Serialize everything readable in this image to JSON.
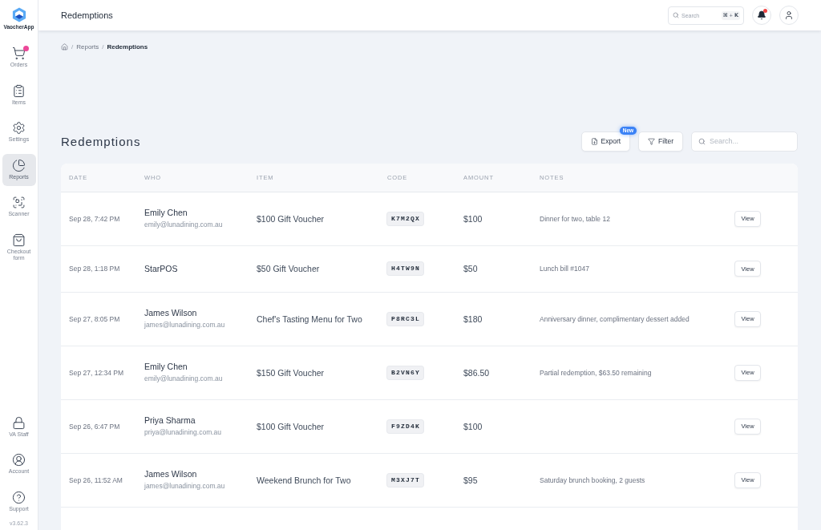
{
  "sidebar": {
    "logo": "VaocherApp",
    "items": [
      {
        "label": "Orders",
        "selected": false,
        "alert": true
      },
      {
        "label": "Items",
        "selected": false,
        "alert": false
      },
      {
        "label": "Settings",
        "selected": false,
        "alert": false
      },
      {
        "label": "Reports",
        "selected": true,
        "alert": false
      },
      {
        "label": "Scanner",
        "selected": false,
        "alert": false
      },
      {
        "label": "Checkout form",
        "selected": false,
        "alert": false
      }
    ],
    "bottom_items": [
      {
        "label": "VA Staff",
        "selected": false
      },
      {
        "label": "Account",
        "selected": false
      },
      {
        "label": "Support",
        "selected": false
      }
    ],
    "version": "v3.62.3"
  },
  "topbar": {
    "title": "Redemptions",
    "search": {
      "placeholder": "Search",
      "shortcut": {
        "keys": [
          "⌘",
          "K"
        ],
        "joiner": "+"
      }
    },
    "notifications": {
      "unread": true
    }
  },
  "breadcrumb": {
    "separator": "/",
    "items": [
      {
        "label": "Reports",
        "current": false
      },
      {
        "label": "Redemptions",
        "current": true
      }
    ]
  },
  "page": {
    "title": "Redemptions",
    "export": {
      "label": "Export",
      "badge": "New"
    },
    "filter": {
      "label": "Filter"
    },
    "search": {
      "placeholder": "Search..."
    }
  },
  "table": {
    "columns": [
      "DATE",
      "WHO",
      "ITEM",
      "CODE",
      "AMOUNT",
      "NOTES"
    ],
    "rows": [
      {
        "date": "Sep 28, 7:42 PM",
        "who": {
          "name": "Emily Chen",
          "email": "emily@lunadining.com.au"
        },
        "item": "$100 Gift Voucher",
        "code": "K7M2QX",
        "amount": "$100",
        "notes": "Dinner for two, table 12",
        "action": "View"
      },
      {
        "date": "Sep 28, 1:18 PM",
        "who": {
          "name": "StarPOS"
        },
        "item": "$50 Gift Voucher",
        "code": "H4TW9N",
        "amount": "$50",
        "notes": "Lunch bill #1047",
        "action": "View"
      },
      {
        "date": "Sep 27, 8:05 PM",
        "who": {
          "name": "James Wilson",
          "email": "james@lunadining.com.au"
        },
        "item": "Chef's Tasting Menu for Two",
        "code": "P8RC3L",
        "amount": "$180",
        "notes": "Anniversary dinner, complimentary dessert added",
        "action": "View"
      },
      {
        "date": "Sep 27, 12:34 PM",
        "who": {
          "name": "Emily Chen",
          "email": "emily@lunadining.com.au"
        },
        "item": "$150 Gift Voucher",
        "code": "B2VN6Y",
        "amount": "$86.50",
        "notes": "Partial redemption, $63.50 remaining",
        "action": "View"
      },
      {
        "date": "Sep 26, 6:47 PM",
        "who": {
          "name": "Priya Sharma",
          "email": "priya@lunadining.com.au"
        },
        "item": "$100 Gift Voucher",
        "code": "F9ZD4K",
        "amount": "$100",
        "action": "View"
      },
      {
        "date": "Sep 26, 11:52 AM",
        "who": {
          "name": "James Wilson",
          "email": "james@lunadining.com.au"
        },
        "item": "Weekend Brunch for Two",
        "code": "M3XJ7T",
        "amount": "$95",
        "notes": "Saturday brunch booking, 2 guests",
        "action": "View"
      }
    ]
  }
}
